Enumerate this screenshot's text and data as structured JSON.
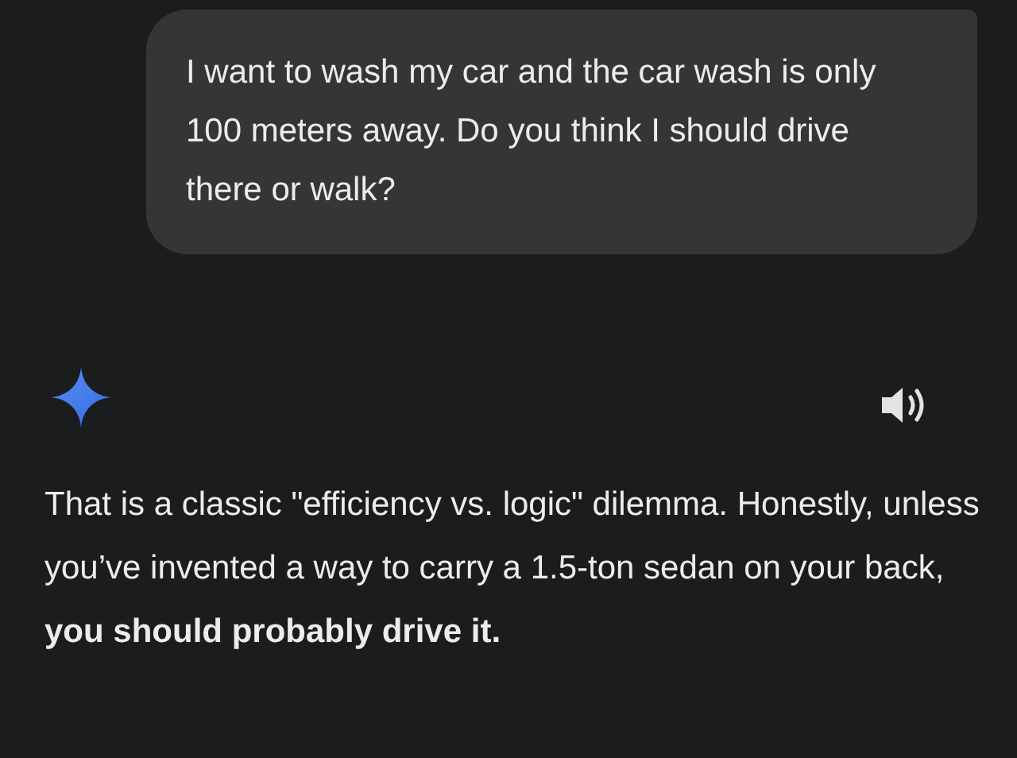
{
  "user_message": {
    "text": "I want to wash my car and the car wash is only 100 meters away. Do you think I should drive there or walk?"
  },
  "response": {
    "text": "That is a classic \"efficiency vs. logic\" dilemma. Honestly, unless you’ve invented a way to carry a 1.5-ton sedan on your back, **you should probably drive it.**"
  }
}
